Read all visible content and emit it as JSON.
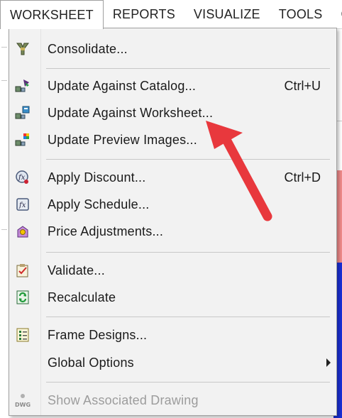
{
  "menubar": {
    "items": [
      {
        "label": "WORKSHEET",
        "active": true
      },
      {
        "label": "REPORTS",
        "active": false
      },
      {
        "label": "VISUALIZE",
        "active": false
      },
      {
        "label": "TOOLS",
        "active": false
      },
      {
        "label": "C",
        "active": false
      }
    ]
  },
  "menu": {
    "items": [
      {
        "label": "Consolidate...",
        "shortcut": "",
        "icon": "consolidate-icon"
      },
      {
        "label": "Update Against Catalog...",
        "shortcut": "Ctrl+U",
        "icon": "update-catalog-icon"
      },
      {
        "label": "Update Against Worksheet...",
        "shortcut": "",
        "icon": "update-worksheet-icon"
      },
      {
        "label": "Update Preview Images...",
        "shortcut": "",
        "icon": "update-preview-images-icon"
      },
      {
        "label": "Apply Discount...",
        "shortcut": "Ctrl+D",
        "icon": "apply-discount-icon"
      },
      {
        "label": "Apply Schedule...",
        "shortcut": "",
        "icon": "apply-schedule-icon"
      },
      {
        "label": "Price Adjustments...",
        "shortcut": "",
        "icon": "price-adjustments-icon"
      },
      {
        "label": "Validate...",
        "shortcut": "",
        "icon": "validate-icon"
      },
      {
        "label": "Recalculate",
        "shortcut": "",
        "icon": "recalculate-icon"
      },
      {
        "label": "Frame Designs...",
        "shortcut": "",
        "icon": "frame-designs-icon"
      },
      {
        "label": "Global Options",
        "shortcut": "",
        "icon": "",
        "submenu": true
      },
      {
        "label": "Show Associated Drawing",
        "shortcut": "",
        "icon": "dwg-icon",
        "disabled": true,
        "icon_text": "DWG"
      }
    ]
  },
  "colors": {
    "menu_bg": "#f2f2f2",
    "disabled_text": "#9c9c9c",
    "annotation_arrow": "#e8383d"
  }
}
